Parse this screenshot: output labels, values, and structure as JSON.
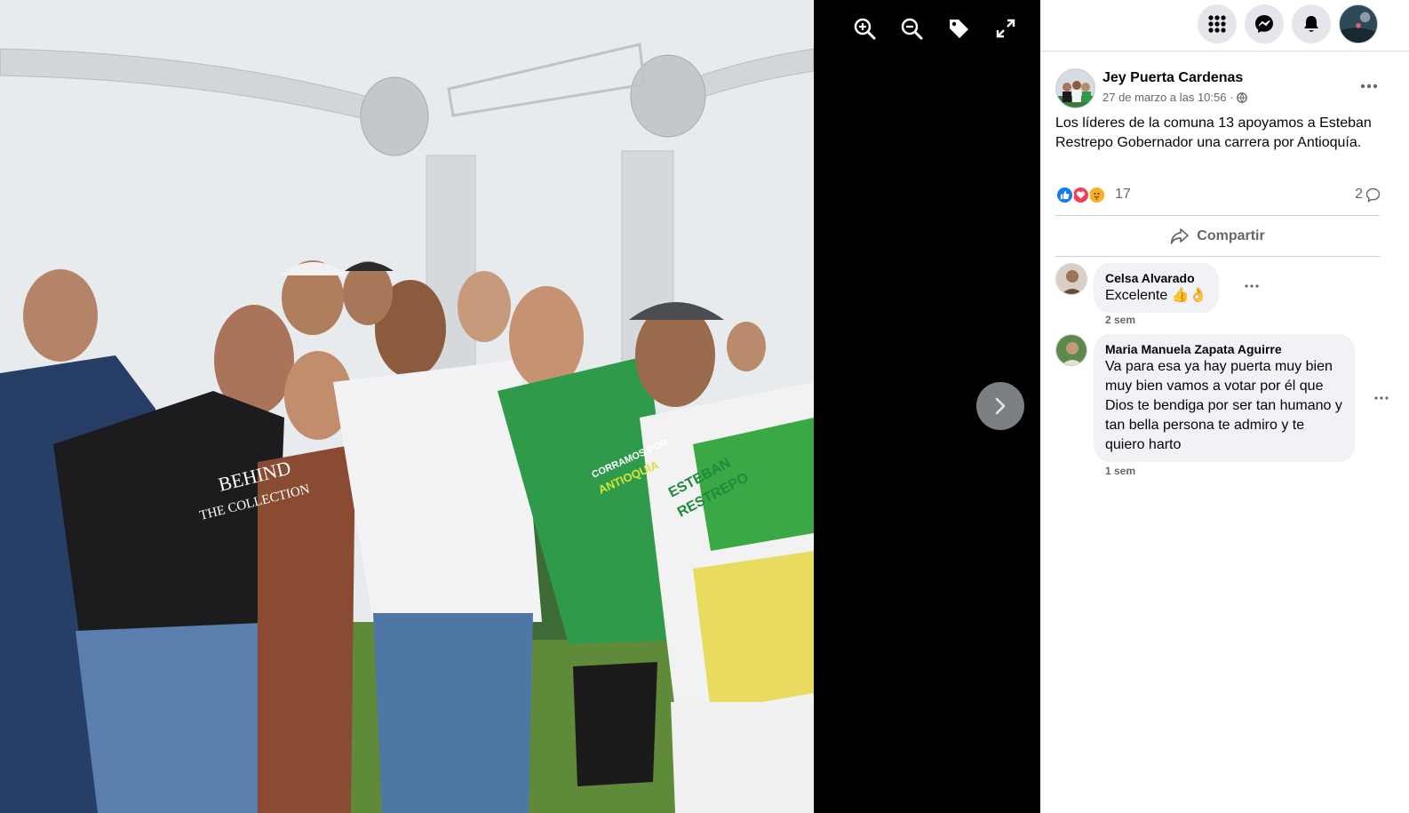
{
  "viewer": {
    "tools": [
      {
        "name": "zoom-in-icon"
      },
      {
        "name": "zoom-out-icon"
      },
      {
        "name": "tag-icon"
      },
      {
        "name": "fullscreen-icon"
      }
    ],
    "next_icon": "chevron-right-icon",
    "photo_text": {
      "shirt_text_1": "BEHIND",
      "shirt_text_2": "THE COLLECTION",
      "jersey_text_1": "CORRAMOS POR",
      "jersey_text_2": "ANTIOQUIA",
      "jersey_text_3": "ESTEBAN",
      "jersey_text_4": "RESTREPO"
    }
  },
  "topbar": {
    "icons": [
      "menu-grid-icon",
      "messenger-icon",
      "notifications-bell-icon",
      "profile-avatar"
    ]
  },
  "post": {
    "author": "Jey Puerta Cardenas",
    "timestamp": "27 de marzo a las 10:56 ·",
    "audience_icon": "globe-icon",
    "text": "Los líderes de la comuna 13 apoyamos a Esteban Restrepo Gobernador una carrera por Antioquía.",
    "reaction_count": "17",
    "reaction_types": [
      "like",
      "love",
      "care"
    ],
    "comment_count": "2",
    "share_label": "Compartir"
  },
  "comments": [
    {
      "name": "Celsa Alvarado",
      "text": "Excelente 👍👌",
      "time": "2 sem"
    },
    {
      "name": "Maria Manuela Zapata Aguirre",
      "text": "Va para esa ya hay puerta muy bien muy bien vamos a votar por él que Dios te bendiga por ser tan humano y tan bella persona te admiro y te quiero harto",
      "time": "1 sem"
    }
  ],
  "colors": {
    "like": "#1877f2",
    "love": "#f33e58",
    "care": "#f7b125",
    "secondary_text": "#65676b",
    "bubble": "#f0f2f5"
  }
}
